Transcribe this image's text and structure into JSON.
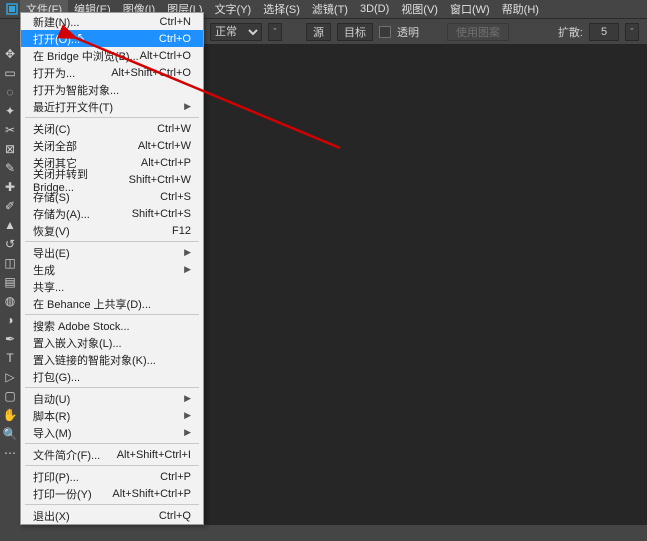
{
  "menubar": {
    "items": [
      {
        "label": "文件(F)"
      },
      {
        "label": "编辑(E)"
      },
      {
        "label": "图像(I)"
      },
      {
        "label": "图层(L)"
      },
      {
        "label": "文字(Y)"
      },
      {
        "label": "选择(S)"
      },
      {
        "label": "滤镜(T)"
      },
      {
        "label": "3D(D)"
      },
      {
        "label": "视图(V)"
      },
      {
        "label": "窗口(W)"
      },
      {
        "label": "帮助(H)"
      }
    ]
  },
  "options": {
    "mode_label": "正常",
    "btn_source": "源",
    "btn_target": "目标",
    "transparent_label": "透明",
    "use_pattern_label": "使用图案",
    "diffusion_label": "扩散:",
    "diffusion_value": "5"
  },
  "file_menu": {
    "items": [
      {
        "label": "新建(N)...",
        "shortcut": "Ctrl+N"
      },
      {
        "label": "打开(O)...",
        "shortcut": "Ctrl+O",
        "highlight": true
      },
      {
        "label": "在 Bridge 中浏览(B)...",
        "shortcut": "Alt+Ctrl+O"
      },
      {
        "label": "打开为...",
        "shortcut": "Alt+Shift+Ctrl+O"
      },
      {
        "label": "打开为智能对象..."
      },
      {
        "label": "最近打开文件(T)",
        "submenu": true
      },
      {
        "separator": true
      },
      {
        "label": "关闭(C)",
        "shortcut": "Ctrl+W"
      },
      {
        "label": "关闭全部",
        "shortcut": "Alt+Ctrl+W"
      },
      {
        "label": "关闭其它",
        "shortcut": "Alt+Ctrl+P"
      },
      {
        "label": "关闭并转到 Bridge...",
        "shortcut": "Shift+Ctrl+W"
      },
      {
        "label": "存储(S)",
        "shortcut": "Ctrl+S"
      },
      {
        "label": "存储为(A)...",
        "shortcut": "Shift+Ctrl+S"
      },
      {
        "label": "恢复(V)",
        "shortcut": "F12"
      },
      {
        "separator": true
      },
      {
        "label": "导出(E)",
        "submenu": true
      },
      {
        "label": "生成",
        "submenu": true
      },
      {
        "label": "共享..."
      },
      {
        "label": "在 Behance 上共享(D)..."
      },
      {
        "separator": true
      },
      {
        "label": "搜索 Adobe Stock..."
      },
      {
        "label": "置入嵌入对象(L)..."
      },
      {
        "label": "置入链接的智能对象(K)..."
      },
      {
        "label": "打包(G)..."
      },
      {
        "separator": true
      },
      {
        "label": "自动(U)",
        "submenu": true
      },
      {
        "label": "脚本(R)",
        "submenu": true
      },
      {
        "label": "导入(M)",
        "submenu": true
      },
      {
        "separator": true
      },
      {
        "label": "文件简介(F)...",
        "shortcut": "Alt+Shift+Ctrl+I"
      },
      {
        "separator": true
      },
      {
        "label": "打印(P)...",
        "shortcut": "Ctrl+P"
      },
      {
        "label": "打印一份(Y)",
        "shortcut": "Alt+Shift+Ctrl+P"
      },
      {
        "separator": true
      },
      {
        "label": "退出(X)",
        "shortcut": "Ctrl+Q"
      }
    ]
  },
  "annotation": {
    "color": "#d40000"
  }
}
